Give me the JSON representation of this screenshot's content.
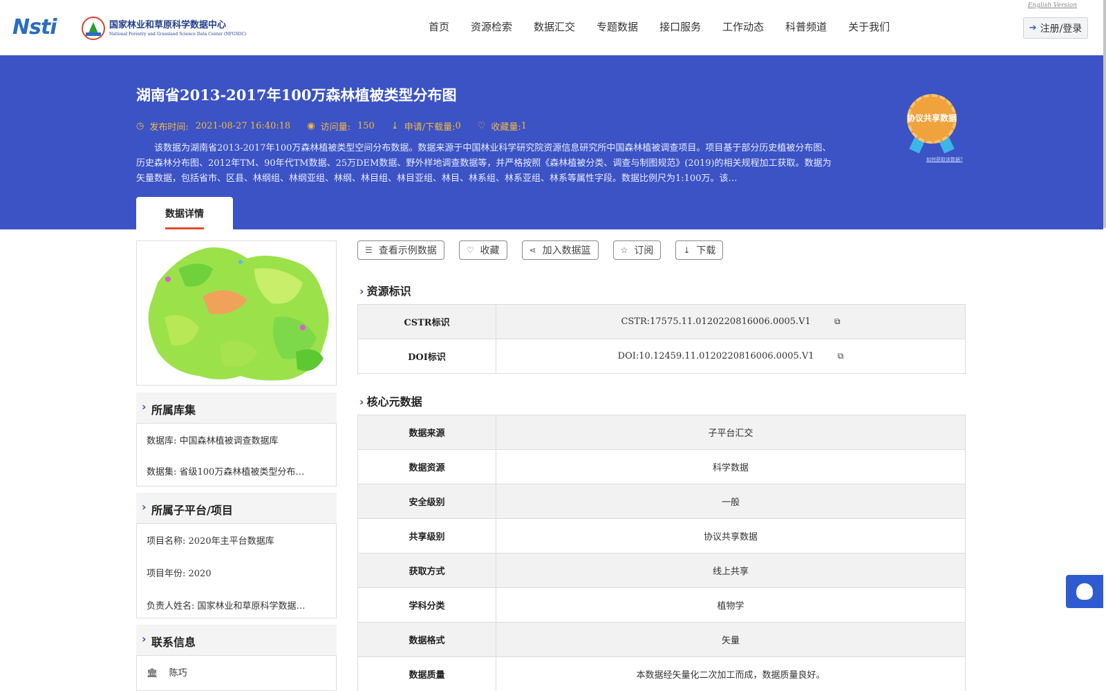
{
  "header": {
    "logo_left": "Nsti",
    "logo_cn": "国家林业和草原科学数据中心",
    "logo_en": "National Forestry and Grassland Science Data Center (NFGSDC)",
    "english_link": "English Version",
    "nav": [
      "首页",
      "资源检索",
      "数据汇交",
      "专题数据",
      "接口服务",
      "工作动态",
      "科普频道",
      "关于我们"
    ],
    "login": "注册/登录"
  },
  "banner": {
    "title": "湖南省2013-2017年100万森林植被类型分布图",
    "publish_label": "发布时间:",
    "publish_time": "2021-08-27 16:40:18",
    "views_label": "访问量:",
    "views": "150",
    "downloads_label": "申请/下载量:",
    "downloads": "0",
    "favorites_label": "收藏量:",
    "favorites": "1",
    "description": "该数据为湖南省2013-2017年100万森林植被类型空间分布数据。数据来源于中国林业科学研究院资源信息研究所中国森林植被调查项目。项目基于部分历史植被分布图、历史森林分布图、2012年TM、90年代TM数据、25万DEM数据、野外样地调查数据等，并严格按照《森林植被分类、调查与制图规范》(2019)的相关规程加工获取。数据为矢量数据，包括省市、区县、林纲组、林纲亚组、林纲、林目组、林目亚组、林目、林系组、林系亚组、林系等属性字段。数据比例尺为1:100万。该…",
    "badge": "协议共享数据",
    "badge_link": "如何获取该数据?",
    "tab": "数据详情"
  },
  "left": {
    "library_title": "所属库集",
    "database": "数据库: 中国森林植被调查数据库",
    "dataset": "数据集: 省级100万森林植被类型分布…",
    "project_title": "所属子平台/项目",
    "project_name": "项目名称: 2020年主平台数据库",
    "project_year": "项目年份: 2020",
    "owner": "负责人姓名: 国家林业和草原科学数据…",
    "contact_title": "联系信息",
    "contact_name": "陈巧"
  },
  "actions": [
    "查看示例数据",
    "收藏",
    "加入数据篮",
    "订阅",
    "下载"
  ],
  "resource": {
    "title": "资源标识",
    "rows": [
      {
        "k": "CSTR标识",
        "v": "CSTR:17575.11.0120220816006.0005.V1"
      },
      {
        "k": "DOI标识",
        "v": "DOI:10.12459.11.0120220816006.0005.V1"
      }
    ]
  },
  "core": {
    "title": "核心元数据",
    "rows": [
      {
        "k": "数据来源",
        "v": "子平台汇交"
      },
      {
        "k": "数据资源",
        "v": "科学数据"
      },
      {
        "k": "安全级别",
        "v": "一般"
      },
      {
        "k": "共享级别",
        "v": "协议共享数据"
      },
      {
        "k": "获取方式",
        "v": "线上共享"
      },
      {
        "k": "学科分类",
        "v": "植物学"
      },
      {
        "k": "数据格式",
        "v": "矢量"
      },
      {
        "k": "数据质量",
        "v": "本数据经矢量化二次加工而成，数据质量良好。"
      }
    ]
  },
  "colors": {
    "banner": "#3b53c4",
    "meta": "#f5b942",
    "tab_underline": "#e24b2b"
  }
}
